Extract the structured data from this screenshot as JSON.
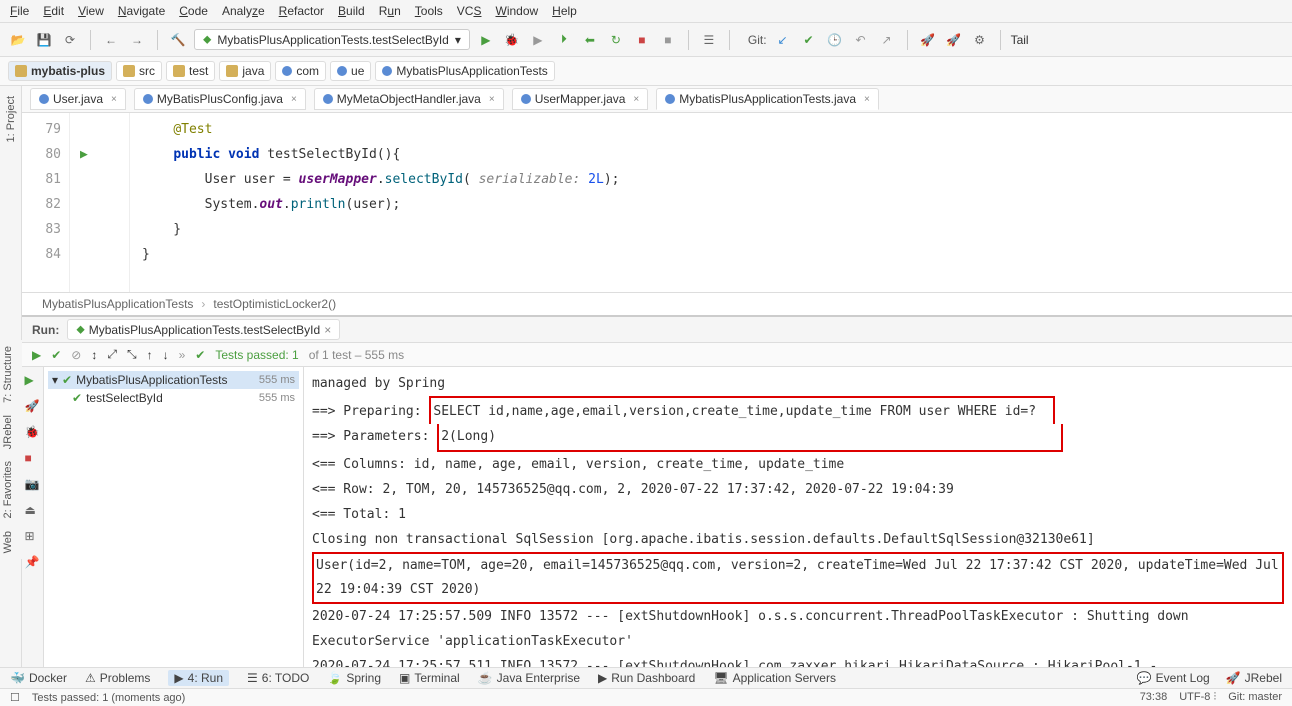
{
  "menu": {
    "file": "File",
    "edit": "Edit",
    "view": "View",
    "navigate": "Navigate",
    "code": "Code",
    "analyze": "Analyze",
    "refactor": "Refactor",
    "build": "Build",
    "run": "Run",
    "tools": "Tools",
    "vcs": "VCS",
    "window": "Window",
    "help": "Help"
  },
  "toolbar": {
    "runConfig": "MybatisPlusApplicationTests.testSelectById",
    "gitLabel": "Git:",
    "tail": "Tail"
  },
  "breadcrumb": {
    "root": "mybatis-plus",
    "src": "src",
    "test": "test",
    "java": "java",
    "com": "com",
    "ue": "ue",
    "cls": "MybatisPlusApplicationTests"
  },
  "fileTabs": {
    "user": "User.java",
    "config": "MyBatisPlusConfig.java",
    "handler": "MyMetaObjectHandler.java",
    "mapper": "UserMapper.java",
    "tests": "MybatisPlusApplicationTests.java"
  },
  "editor": {
    "lines": {
      "l79": "79",
      "l80": "80",
      "l81": "81",
      "l82": "82",
      "l83": "83",
      "l84": "84"
    },
    "ann": "@Test",
    "kwPublic": "public",
    "kwVoid": "void",
    "methodName": "testSelectById",
    "sig": "(){",
    "l81p1": "        User user = ",
    "field": "userMapper",
    "l81p2": ".",
    "method": "selectById",
    "l81p3": "( ",
    "param": "serializable:",
    "num": "2L",
    "l81p4": ");",
    "l82p1": "        System.",
    "out": "out",
    "l82p2": ".",
    "println": "println",
    "l82p3": "(user);",
    "l83": "    }",
    "l84": "}"
  },
  "editorCrumb": {
    "cls": "MybatisPlusApplicationTests",
    "method": "testOptimisticLocker2()"
  },
  "run": {
    "label": "Run:",
    "tab": "MybatisPlusApplicationTests.testSelectById",
    "testsPassedPrefix": "Tests passed: 1",
    "testsPassedSuffix": " of 1 test – 555 ms",
    "tree": {
      "root": "MybatisPlusApplicationTests",
      "method": "testSelectById",
      "time": "555 ms"
    },
    "console": {
      "l1": "        managed by Spring",
      "l2a": "==>  Preparing: ",
      "l2b": "SELECT id,name,age,email,version,create_time,update_time FROM user WHERE id=?",
      "l3a": "==> Parameters: ",
      "l3b": "2(Long)",
      "l4": "<==    Columns: id, name, age, email, version, create_time, update_time",
      "l5": "<==        Row: 2, TOM, 20, 145736525@qq.com, 2, 2020-07-22 17:37:42, 2020-07-22 19:04:39",
      "l6": "<==      Total: 1",
      "l7": "Closing non transactional SqlSession [org.apache.ibatis.session.defaults.DefaultSqlSession@32130e61]",
      "l8": "User(id=2, name=TOM, age=20, email=145736525@qq.com, version=2, createTime=Wed Jul 22 17:37:42 CST 2020, updateTime=Wed Jul 22 19:04:39 CST 2020)",
      "l10": "2020-07-24 17:25:57.509  INFO 13572 --- [extShutdownHook] o.s.s.concurrent.ThreadPoolTaskExecutor  : Shutting down ExecutorService 'applicationTaskExecutor'",
      "l11": "2020-07-24 17:25:57.511  INFO 13572 --- [extShutdownHook] com.zaxxer.hikari.HikariDataSource       : HikariPool-1 -"
    }
  },
  "bottomTools": {
    "docker": "Docker",
    "problems": "Problems",
    "run": "4: Run",
    "todo": "6: TODO",
    "spring": "Spring",
    "terminal": "Terminal",
    "javaee": "Java Enterprise",
    "rundash": "Run Dashboard",
    "appservers": "Application Servers",
    "eventlog": "Event Log",
    "jrebel": "JRebel"
  },
  "status": {
    "msg": "Tests passed: 1 (moments ago)",
    "pos": "73:38",
    "encoding": "UTF-8",
    "git": "Git: master"
  },
  "sideTabs": {
    "project": "1: Project",
    "structure": "7: Structure",
    "jrebel": "JRebel",
    "favorites": "2: Favorites",
    "web": "Web"
  }
}
